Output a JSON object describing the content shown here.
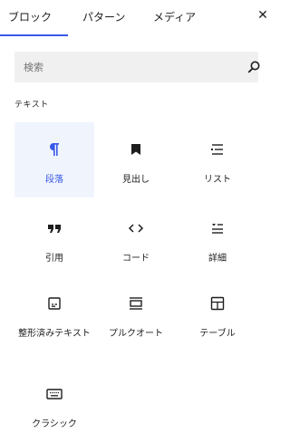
{
  "tabs": [
    {
      "label": "ブロック",
      "active": true
    },
    {
      "label": "パターン",
      "active": false
    },
    {
      "label": "メディア",
      "active": false
    }
  ],
  "close_icon": "close-icon",
  "search": {
    "placeholder": "検索",
    "value": "",
    "icon": "search-icon"
  },
  "category": "テキスト",
  "accent_color": "#3858e9",
  "blocks": [
    {
      "label": "段落",
      "icon": "paragraph-icon",
      "selected": true
    },
    {
      "label": "見出し",
      "icon": "heading-bookmark-icon",
      "selected": false
    },
    {
      "label": "リスト",
      "icon": "list-icon",
      "selected": false
    },
    {
      "label": "引用",
      "icon": "quote-icon",
      "selected": false
    },
    {
      "label": "コード",
      "icon": "code-icon",
      "selected": false
    },
    {
      "label": "詳細",
      "icon": "details-icon",
      "selected": false
    },
    {
      "label": "整形済みテキスト",
      "icon": "preformatted-icon",
      "selected": false
    },
    {
      "label": "プルクオート",
      "icon": "pullquote-icon",
      "selected": false
    },
    {
      "label": "テーブル",
      "icon": "table-icon",
      "selected": false
    },
    {
      "label": "クラシック",
      "icon": "keyboard-icon",
      "selected": false
    }
  ]
}
